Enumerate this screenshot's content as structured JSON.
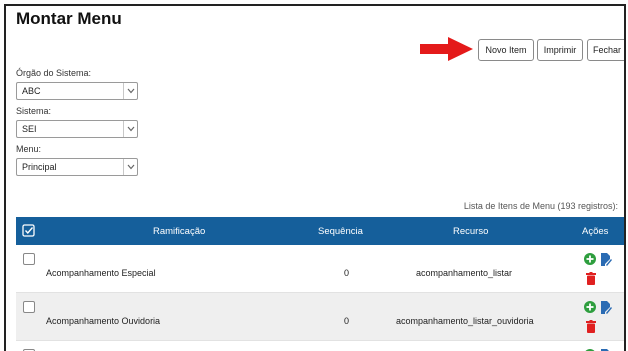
{
  "page": {
    "title": "Montar Menu",
    "buttons": {
      "new_item": "Novo Item",
      "print": "Imprimir",
      "close": "Fechar"
    }
  },
  "filters": {
    "orgao": {
      "label": "Órgão do Sistema:",
      "value": "ABC"
    },
    "sistema": {
      "label": "Sistema:",
      "value": "SEI"
    },
    "menu": {
      "label": "Menu:",
      "value": "Principal"
    }
  },
  "table": {
    "caption": "Lista de Itens de Menu (193 registros):",
    "headers": {
      "ramificacao": "Ramificação",
      "sequencia": "Sequência",
      "recurso": "Recurso",
      "acoes": "Ações"
    },
    "rows": [
      {
        "ramificacao": "Acompanhamento Especial",
        "sequencia": "0",
        "recurso": "acompanhamento_listar"
      },
      {
        "ramificacao": "Acompanhamento Ouvidoria",
        "sequencia": "0",
        "recurso": "acompanhamento_listar_ouvidoria"
      }
    ]
  },
  "colors": {
    "header_bg": "#155f9b",
    "add_icon": "#2e9e3e",
    "edit_icon": "#2a6bb3",
    "delete_icon": "#e02020",
    "arrow": "#e41a1a"
  },
  "icons": [
    "chevron-down-icon",
    "checkbox-icon",
    "add-circle-icon",
    "edit-icon",
    "trash-icon",
    "arrow-annotation"
  ]
}
